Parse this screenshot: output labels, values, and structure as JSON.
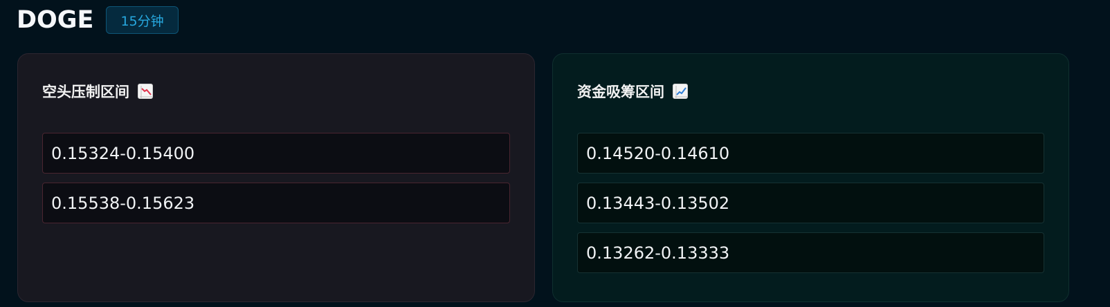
{
  "header": {
    "symbol": "DOGE",
    "timeframe": "15分钟"
  },
  "bear_panel": {
    "title": "空头压制区间",
    "icon": "chart-decreasing-icon",
    "accent_color": "#e0314b",
    "ranges": [
      "0.15324-0.15400",
      "0.15538-0.15623"
    ]
  },
  "bull_panel": {
    "title": "资金吸筹区间",
    "icon": "chart-increasing-icon",
    "accent_color": "#2f7fd8",
    "ranges": [
      "0.14520-0.14610",
      "0.13443-0.13502",
      "0.13262-0.13333"
    ]
  }
}
